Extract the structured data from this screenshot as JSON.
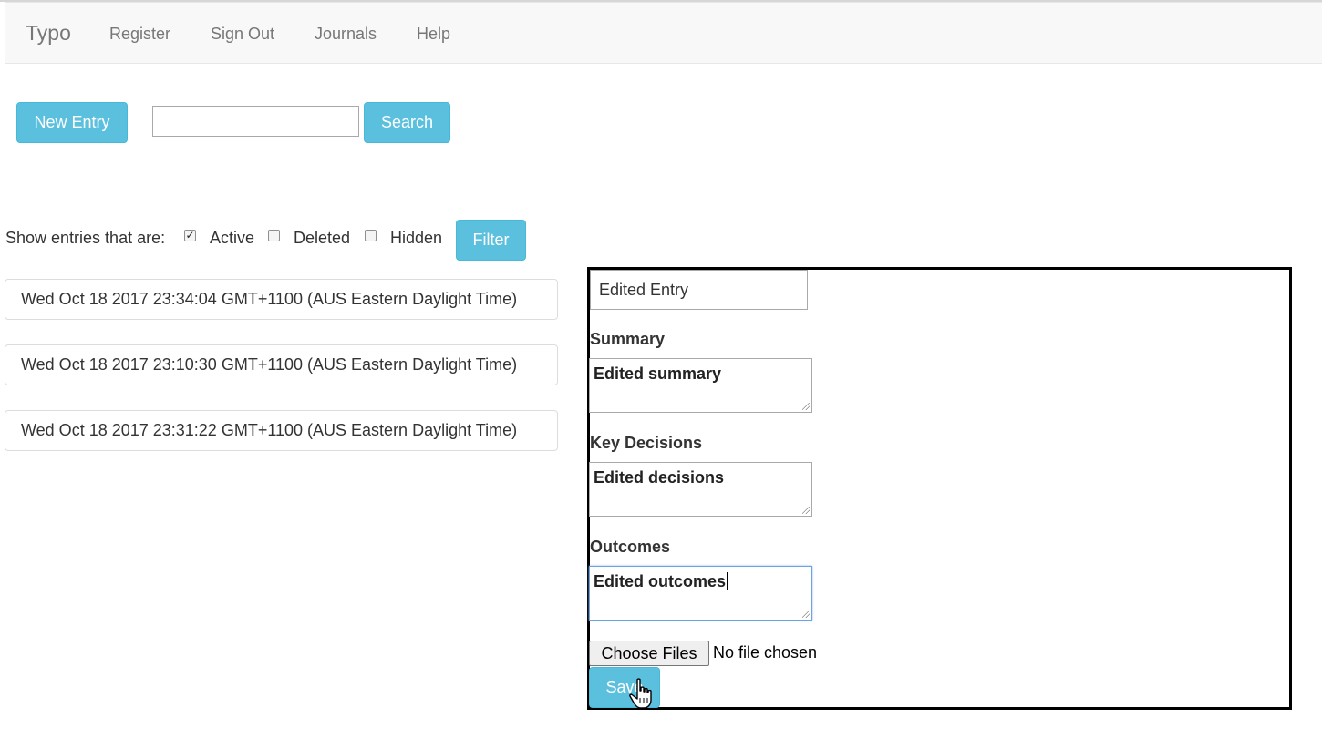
{
  "navbar": {
    "brand": "Typo",
    "links": [
      "Register",
      "Sign Out",
      "Journals",
      "Help"
    ]
  },
  "toolbar": {
    "new_entry_label": "New Entry",
    "search_value": "",
    "search_label": "Search"
  },
  "filter": {
    "prompt": "Show entries that are:",
    "options": [
      {
        "label": "Active",
        "checked": true
      },
      {
        "label": "Deleted",
        "checked": false
      },
      {
        "label": "Hidden",
        "checked": false
      }
    ],
    "button_label": "Filter"
  },
  "entries": [
    "Wed Oct 18 2017 23:34:04 GMT+1100 (AUS Eastern Daylight Time)",
    "Wed Oct 18 2017 23:10:30 GMT+1100 (AUS Eastern Daylight Time)",
    "Wed Oct 18 2017 23:31:22 GMT+1100 (AUS Eastern Daylight Time)"
  ],
  "edit_form": {
    "title_value": "Edited Entry",
    "summary_label": "Summary",
    "summary_value": "Edited summary",
    "decisions_label": "Key Decisions",
    "decisions_value": "Edited decisions",
    "outcomes_label": "Outcomes",
    "outcomes_value": "Edited outcomes",
    "choose_files_label": "Choose Files",
    "file_status": "No file chosen",
    "save_label": "Save"
  },
  "colors": {
    "button_info": "#5bc0de",
    "navbar_bg": "#f8f8f8",
    "panel_border": "#000000"
  }
}
